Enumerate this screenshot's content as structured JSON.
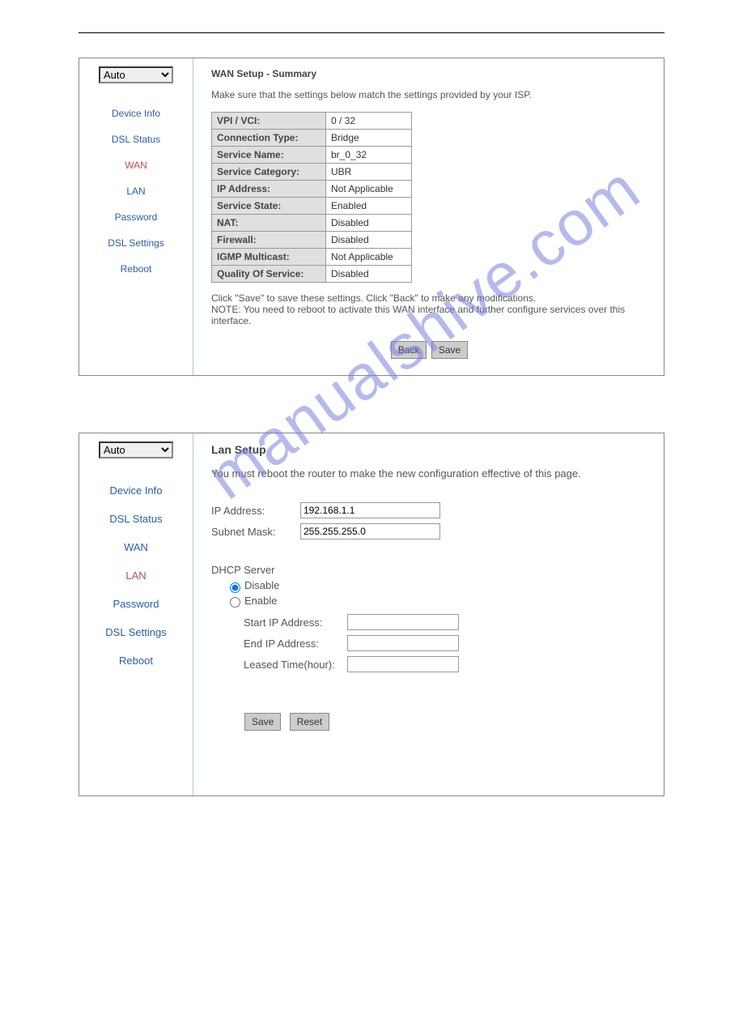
{
  "watermark": "manualshive.com",
  "panel1": {
    "sidebar": {
      "select": "Auto",
      "items": [
        "Device Info",
        "DSL Status",
        "WAN",
        "LAN",
        "Password",
        "DSL Settings",
        "Reboot"
      ],
      "active_index": 2
    },
    "title": "WAN Setup - Summary",
    "desc": "Make sure that the settings below match the settings provided by your ISP.",
    "rows": [
      {
        "label": "VPI / VCI:",
        "value": "0 / 32"
      },
      {
        "label": "Connection Type:",
        "value": "Bridge"
      },
      {
        "label": "Service Name:",
        "value": "br_0_32"
      },
      {
        "label": "Service Category:",
        "value": "UBR"
      },
      {
        "label": "IP Address:",
        "value": "Not Applicable"
      },
      {
        "label": "Service State:",
        "value": "Enabled"
      },
      {
        "label": "NAT:",
        "value": "Disabled"
      },
      {
        "label": "Firewall:",
        "value": "Disabled"
      },
      {
        "label": "IGMP Multicast:",
        "value": "Not Applicable"
      },
      {
        "label": "Quality Of Service:",
        "value": "Disabled"
      }
    ],
    "note_line1": "Click \"Save\" to save these settings. Click \"Back\" to make any modifications.",
    "note_line2": "NOTE: You need to reboot to activate this WAN interface and further configure services over this interface.",
    "buttons": {
      "back": "Back",
      "save": "Save"
    }
  },
  "panel2": {
    "sidebar": {
      "select": "Auto",
      "items": [
        "Device Info",
        "DSL Status",
        "WAN",
        "LAN",
        "Password",
        "DSL Settings",
        "Reboot"
      ],
      "active_index": 3
    },
    "title": "Lan Setup",
    "desc": "You must reboot the router to make the new configuration effective of this page.",
    "ip_label": "IP Address:",
    "ip_value": "192.168.1.1",
    "mask_label": "Subnet Mask:",
    "mask_value": "255.255.255.0",
    "dhcp_label": "DHCP Server",
    "radio_disable": "Disable",
    "radio_enable": "Enable",
    "start_label": "Start IP Address:",
    "start_value": "",
    "end_label": "End IP Address:",
    "end_value": "",
    "leased_label": "Leased Time(hour):",
    "leased_value": "",
    "buttons": {
      "save": "Save",
      "reset": "Reset"
    }
  }
}
